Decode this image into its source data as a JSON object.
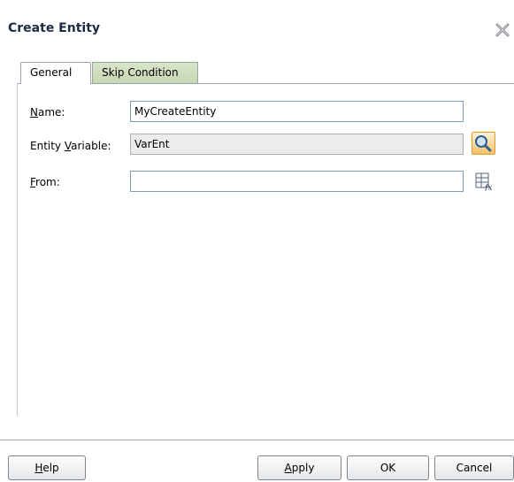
{
  "dialog": {
    "title": "Create Entity",
    "close_icon": "close-icon"
  },
  "tabs": [
    {
      "label": "General",
      "selected": true
    },
    {
      "label": "Skip Condition",
      "selected": false
    }
  ],
  "form": {
    "name_label_mnemonic": "N",
    "name_label_rest": "ame:",
    "name_value": "MyCreateEntity",
    "entity_label_prefix": "Entity ",
    "entity_label_mnemonic": "V",
    "entity_label_rest": "ariable:",
    "entity_value": "VarEnt",
    "entity_browse_icon": "search-icon",
    "from_label_mnemonic": "F",
    "from_label_rest": "rom:",
    "from_value": "",
    "from_expression_icon": "expression-builder-icon"
  },
  "buttons": {
    "help_mnemonic": "H",
    "help_rest": "elp",
    "apply_mnemonic": "A",
    "apply_rest": "pply",
    "ok": "OK",
    "cancel": "Cancel"
  },
  "colors": {
    "title": "#1f2a44",
    "field_border": "#7f9db9",
    "readonly_bg": "#ececec",
    "skip_tab_bg": "#c7d6b3"
  }
}
